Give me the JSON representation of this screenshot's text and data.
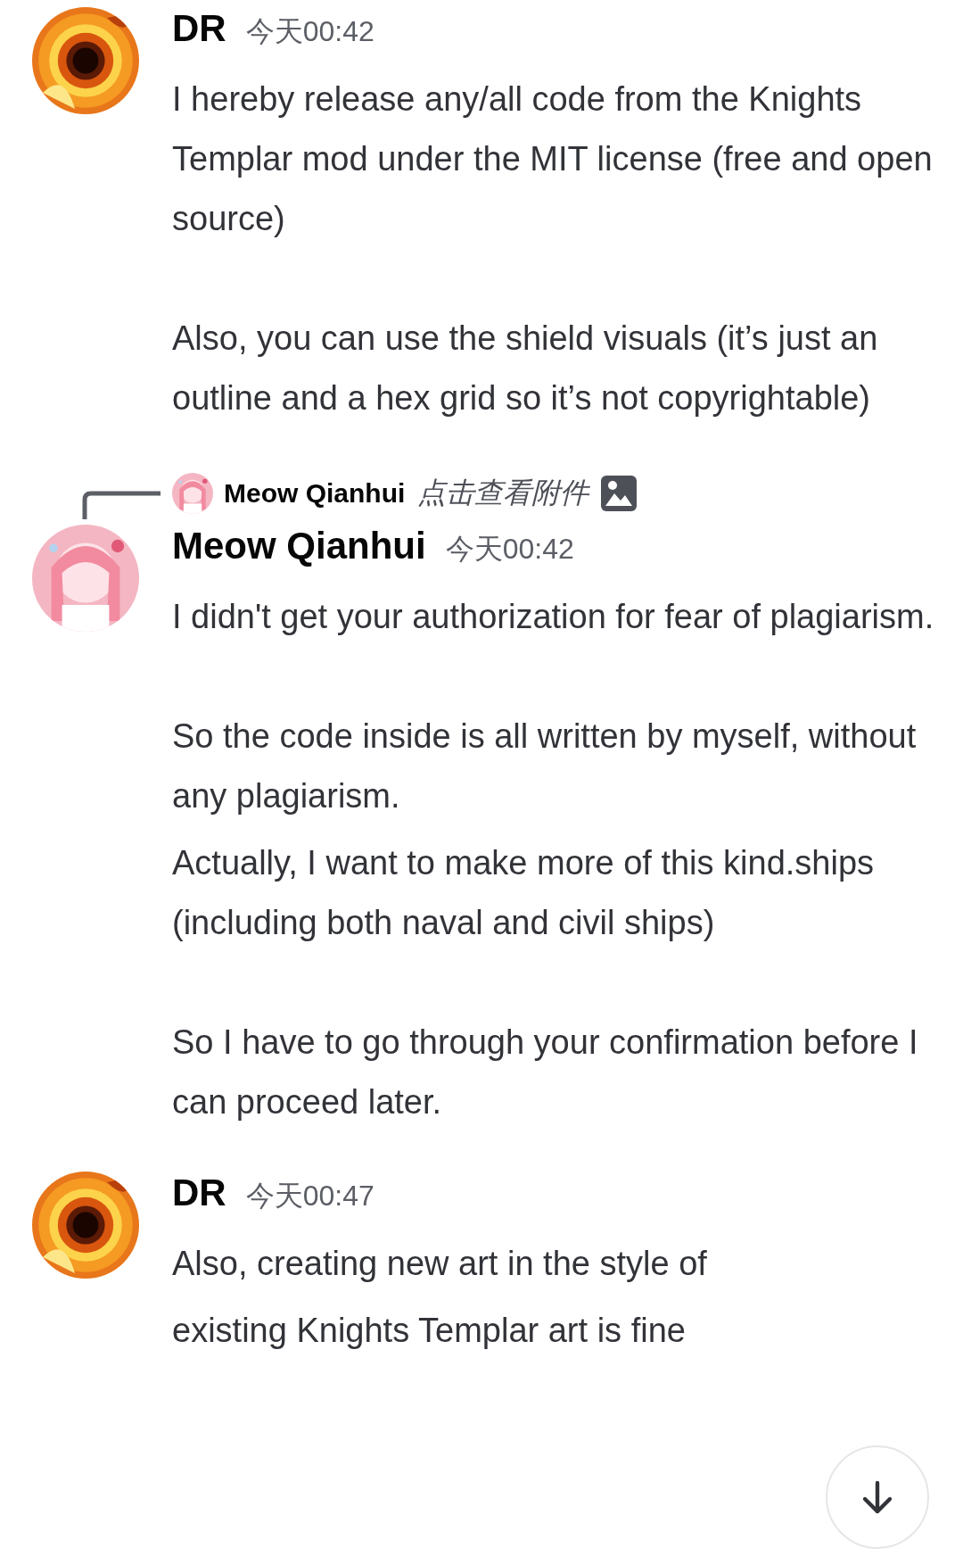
{
  "messages": [
    {
      "author": "DR",
      "time": "今天00:42",
      "avatar": {
        "kind": "picture",
        "color": "#e8761a"
      },
      "body": [
        [
          "I hereby release any/all code from the Knights Templar mod under the MIT license (free and open source)"
        ],
        [
          "Also, you can use the shield visuals (it’s just an outline and a hex grid so it’s not copyrightable)"
        ]
      ]
    },
    {
      "author": "Meow Qianhui",
      "time": "今天00:42",
      "avatar": {
        "kind": "picture",
        "color": "#f4b6c2"
      },
      "reply": {
        "author": "Meow Qianhui",
        "text": "点击查看附件",
        "avatar": {
          "kind": "picture",
          "color": "#f4b6c2"
        }
      },
      "body": [
        [
          "I didn't get your authorization for fear of plagiarism."
        ],
        [
          "So the code inside is all written by myself, without any plagiarism.",
          "Actually, I want to make more of this kind.ships (including both naval and civil ships)"
        ],
        [
          "So I have to go through your confirmation before I can proceed later."
        ]
      ]
    },
    {
      "author": "DR",
      "time": "今天00:47",
      "avatar": {
        "kind": "picture",
        "color": "#e8761a"
      },
      "body": [
        [
          "Also, creating new art in the style of",
          "existing Knights Templar art is fine"
        ]
      ]
    }
  ],
  "jump_button": {
    "kind": "scroll-down"
  }
}
